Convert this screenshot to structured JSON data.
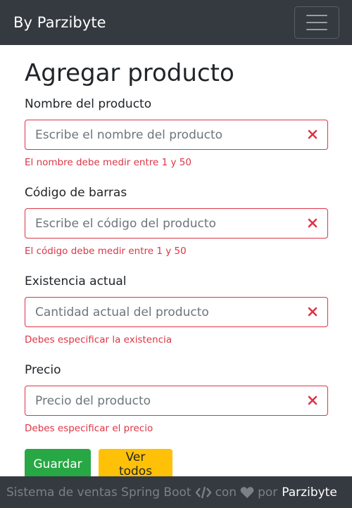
{
  "navbar": {
    "brand": "By Parzibyte",
    "toggler_icon": "hamburger-menu-icon"
  },
  "page": {
    "title": "Agregar producto"
  },
  "form": {
    "nombre": {
      "label": "Nombre del producto",
      "placeholder": "Escribe el nombre del producto",
      "value": "",
      "error": "El nombre debe medir entre 1 y 50"
    },
    "codigo": {
      "label": "Código de barras",
      "placeholder": "Escribe el código del producto",
      "value": "",
      "error": "El código debe medir entre 1 y 50"
    },
    "existencia": {
      "label": "Existencia actual",
      "placeholder": "Cantidad actual del producto",
      "value": "",
      "error": "Debes especificar la existencia"
    },
    "precio": {
      "label": "Precio",
      "placeholder": "Precio del producto",
      "value": "",
      "error": "Debes especificar el precio"
    }
  },
  "buttons": {
    "save": "Guardar",
    "view_all": "Ver todos"
  },
  "footer": {
    "text_before": "Sistema de ventas Spring Boot",
    "code_icon": "code-icon",
    "with": "con",
    "heart_icon": "heart-icon",
    "by": "por",
    "author": "Parzibyte"
  },
  "colors": {
    "navbar_bg": "#343a40",
    "error": "#dc3545",
    "success": "#28a745",
    "warning": "#ffc107"
  }
}
